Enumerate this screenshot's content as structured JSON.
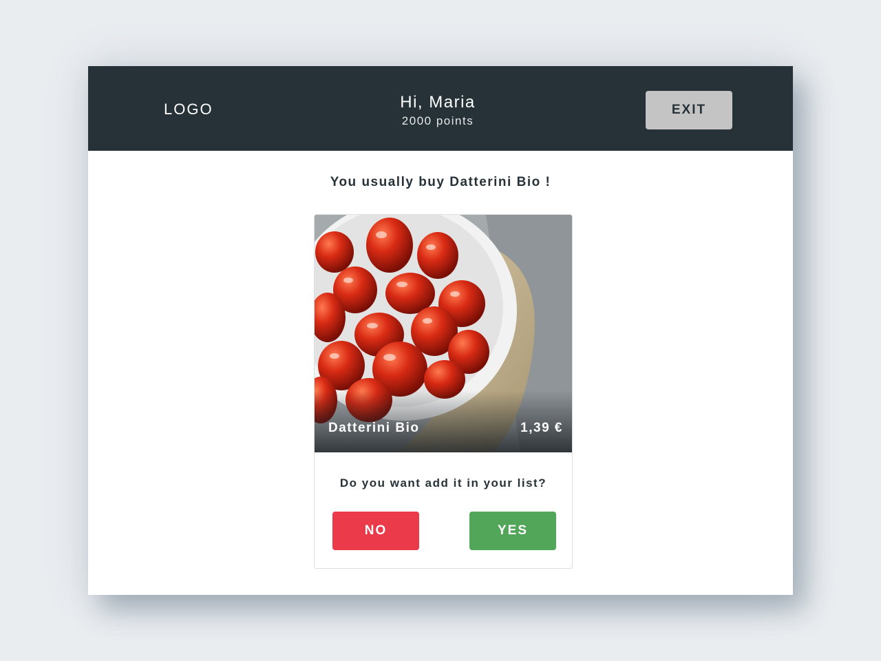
{
  "header": {
    "logo_text": "LOGO",
    "greeting": "Hi, Maria",
    "points": "2000 points",
    "exit_label": "EXIT"
  },
  "main": {
    "suggestion": "You usually buy Datterini Bio !",
    "product": {
      "name": "Datterini Bio",
      "price": "1,39 €"
    },
    "question": "Do you want add it in your list?",
    "no_label": "NO",
    "yes_label": "YES"
  },
  "colors": {
    "header_bg": "#263238",
    "exit_bg": "#c4c4c4",
    "no_bg": "#eb3a4a",
    "yes_bg": "#52a65a"
  }
}
